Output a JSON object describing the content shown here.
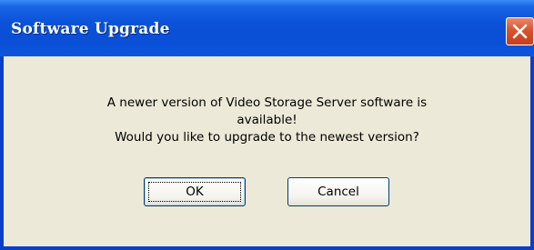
{
  "window": {
    "title": "Software Upgrade"
  },
  "dialog": {
    "message_lines": [
      "A newer version of Video Storage Server software is",
      "available!",
      "Would you like to upgrade to the newest version?"
    ],
    "ok_label": "OK",
    "cancel_label": "Cancel"
  },
  "icons": {
    "close": "close-icon"
  },
  "colors": {
    "titlebar": "#0a52d8",
    "close_button": "#d8532f",
    "client_background": "#ece9d8"
  }
}
